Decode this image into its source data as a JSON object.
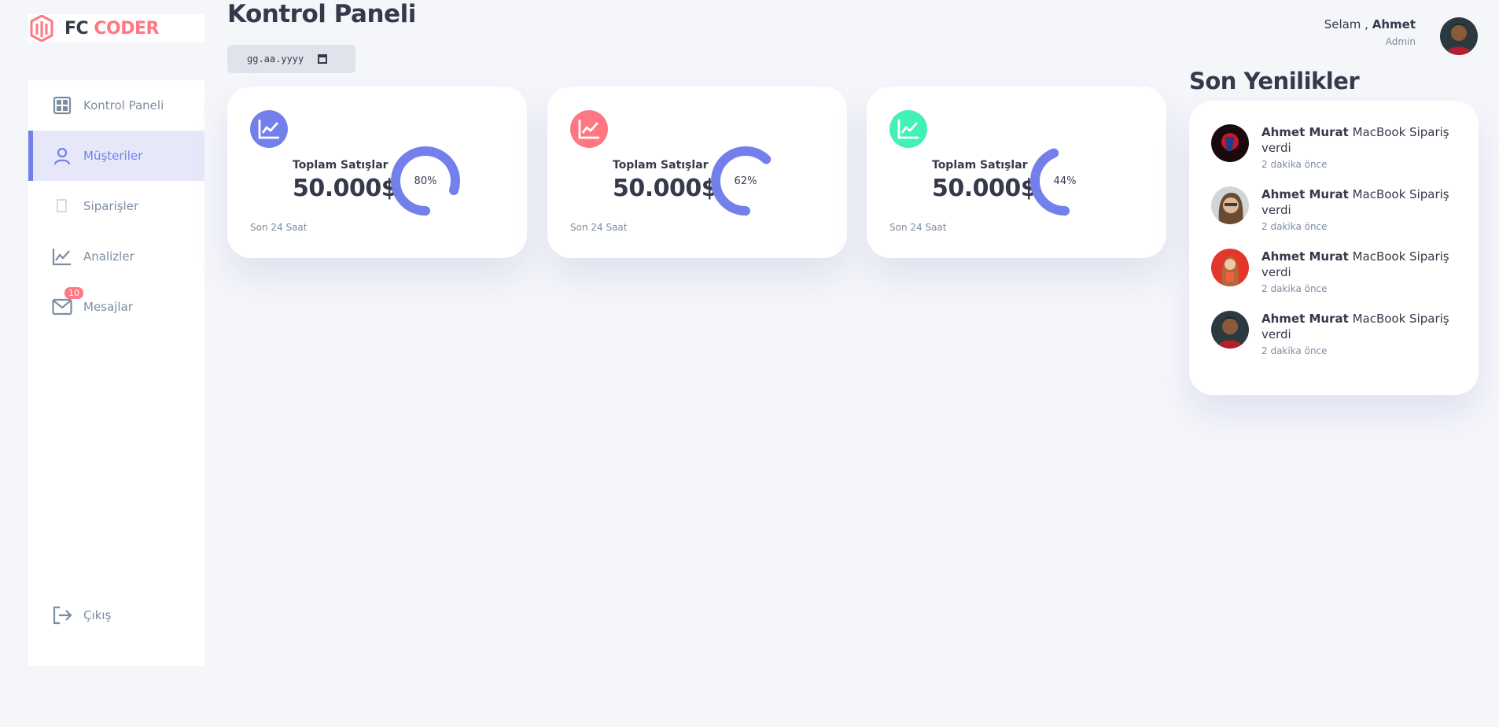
{
  "brand": {
    "part1": "FC",
    "part2": "CODER"
  },
  "sidebar": {
    "items": [
      {
        "label": "Kontrol Paneli",
        "icon": "grid-icon"
      },
      {
        "label": "Müşteriler",
        "icon": "person-icon",
        "active": true
      },
      {
        "label": "Siparişler",
        "icon": "receipt-icon"
      },
      {
        "label": "Analizler",
        "icon": "chart-icon"
      },
      {
        "label": "Mesajlar",
        "icon": "mail-icon",
        "badge": "10"
      },
      {
        "label": "Çıkış",
        "icon": "logout-icon"
      }
    ]
  },
  "header": {
    "title": "Kontrol Paneli",
    "date_placeholder": "gg.aa.yyyy",
    "greeting_prefix": "Selam ,",
    "user_name": "Ahmet",
    "role": "Admin"
  },
  "cards": [
    {
      "label": "Toplam Satışlar",
      "amount": "50.000$",
      "percent_text": "80%",
      "percent": 80,
      "sub": "Son 24 Saat",
      "icon_color": "#7380ec"
    },
    {
      "label": "Toplam Satışlar",
      "amount": "50.000$",
      "percent_text": "62%",
      "percent": 62,
      "sub": "Son 24 Saat",
      "icon_color": "#ff7782"
    },
    {
      "label": "Toplam Satışlar",
      "amount": "50.000$",
      "percent_text": "44%",
      "percent": 44,
      "sub": "Son 24 Saat",
      "icon_color": "#41f1b6"
    }
  ],
  "updates": {
    "title": "Son Yenilikler",
    "items": [
      {
        "name": "Ahmet Murat",
        "text": "MacBook Sipariş verdi",
        "time": "2 dakika önce"
      },
      {
        "name": "Ahmet Murat",
        "text": "MacBook Sipariş verdi",
        "time": "2 dakika önce"
      },
      {
        "name": "Ahmet Murat",
        "text": "MacBook Sipariş verdi",
        "time": "2 dakika önce"
      },
      {
        "name": "Ahmet Murat",
        "text": "MacBook Sipariş verdi",
        "time": "2 dakika önce"
      }
    ]
  },
  "colors": {
    "primary": "#7380ec",
    "danger": "#ff7782",
    "success": "#41f1b6",
    "dark": "#363949",
    "muted": "#7d8da1"
  }
}
